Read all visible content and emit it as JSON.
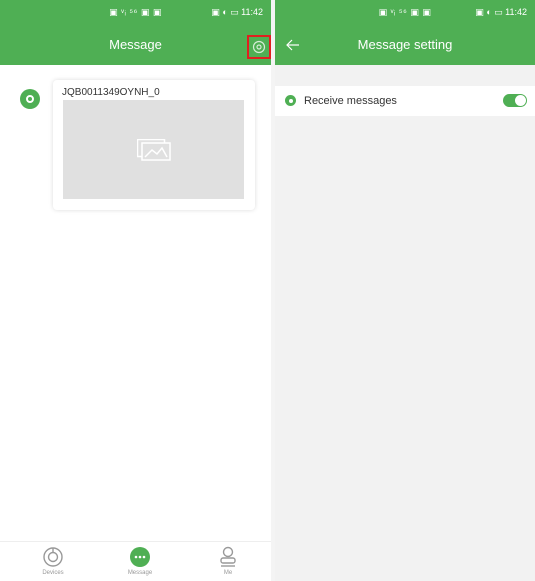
{
  "left": {
    "status": {
      "center": "▣ ᵛᵢ ⁵⁶ ▣ ▣",
      "right": "▣ ◐ ▭ 11:42"
    },
    "appbar": {
      "title": "Message"
    },
    "message": {
      "sender": "JQB0011349OYNH_0"
    },
    "nav": [
      {
        "label": "Devices",
        "icon": "devices-icon",
        "active": false
      },
      {
        "label": "Message",
        "icon": "message-icon",
        "active": true
      },
      {
        "label": "Me",
        "icon": "me-icon",
        "active": false
      }
    ]
  },
  "right": {
    "status": {
      "center": "▣ ᵛᵢ ⁵⁶ ▣ ▣",
      "right": "▣ ◐ ▭ 11:42"
    },
    "appbar": {
      "title": "Message setting"
    },
    "setting": {
      "label": "Receive messages",
      "enabled": true
    }
  },
  "colors": {
    "primary": "#4faf54",
    "highlight": "#e02020"
  }
}
